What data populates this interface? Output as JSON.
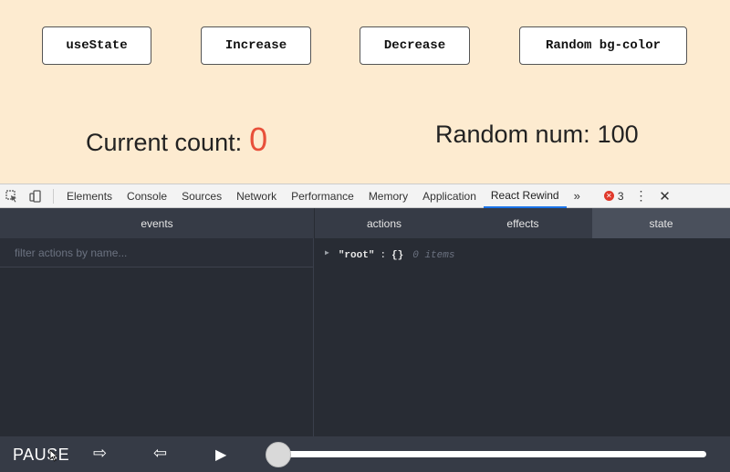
{
  "app": {
    "buttons": [
      "useState",
      "Increase",
      "Decrease",
      "Random bg-color"
    ],
    "count_label": "Current count:",
    "count_value": "0",
    "random_label": "Random num:",
    "random_value": "100",
    "colors": {
      "background": "#fdebd0",
      "count": "#e8503a"
    }
  },
  "devtools": {
    "tabs": [
      "Elements",
      "Console",
      "Sources",
      "Network",
      "Performance",
      "Memory",
      "Application",
      "React Rewind"
    ],
    "active_tab": "React Rewind",
    "more": "»",
    "error_count": "3",
    "icons": [
      "inspect-icon",
      "device-toolbar-icon",
      "error-icon",
      "kebab-menu-icon",
      "close-icon"
    ]
  },
  "rewind": {
    "events_header": "events",
    "filter_placeholder": "filter actions by name...",
    "right_tabs": [
      "actions",
      "effects",
      "state"
    ],
    "active_right_tab": "state",
    "tree": {
      "key": "\"root\"",
      "colon": ":",
      "value": "{}",
      "count": "0 items"
    },
    "controls": {
      "pause": "PAUSE",
      "forward": "⇨",
      "back": "⇦",
      "play": "▶",
      "slider_value": 0
    }
  }
}
